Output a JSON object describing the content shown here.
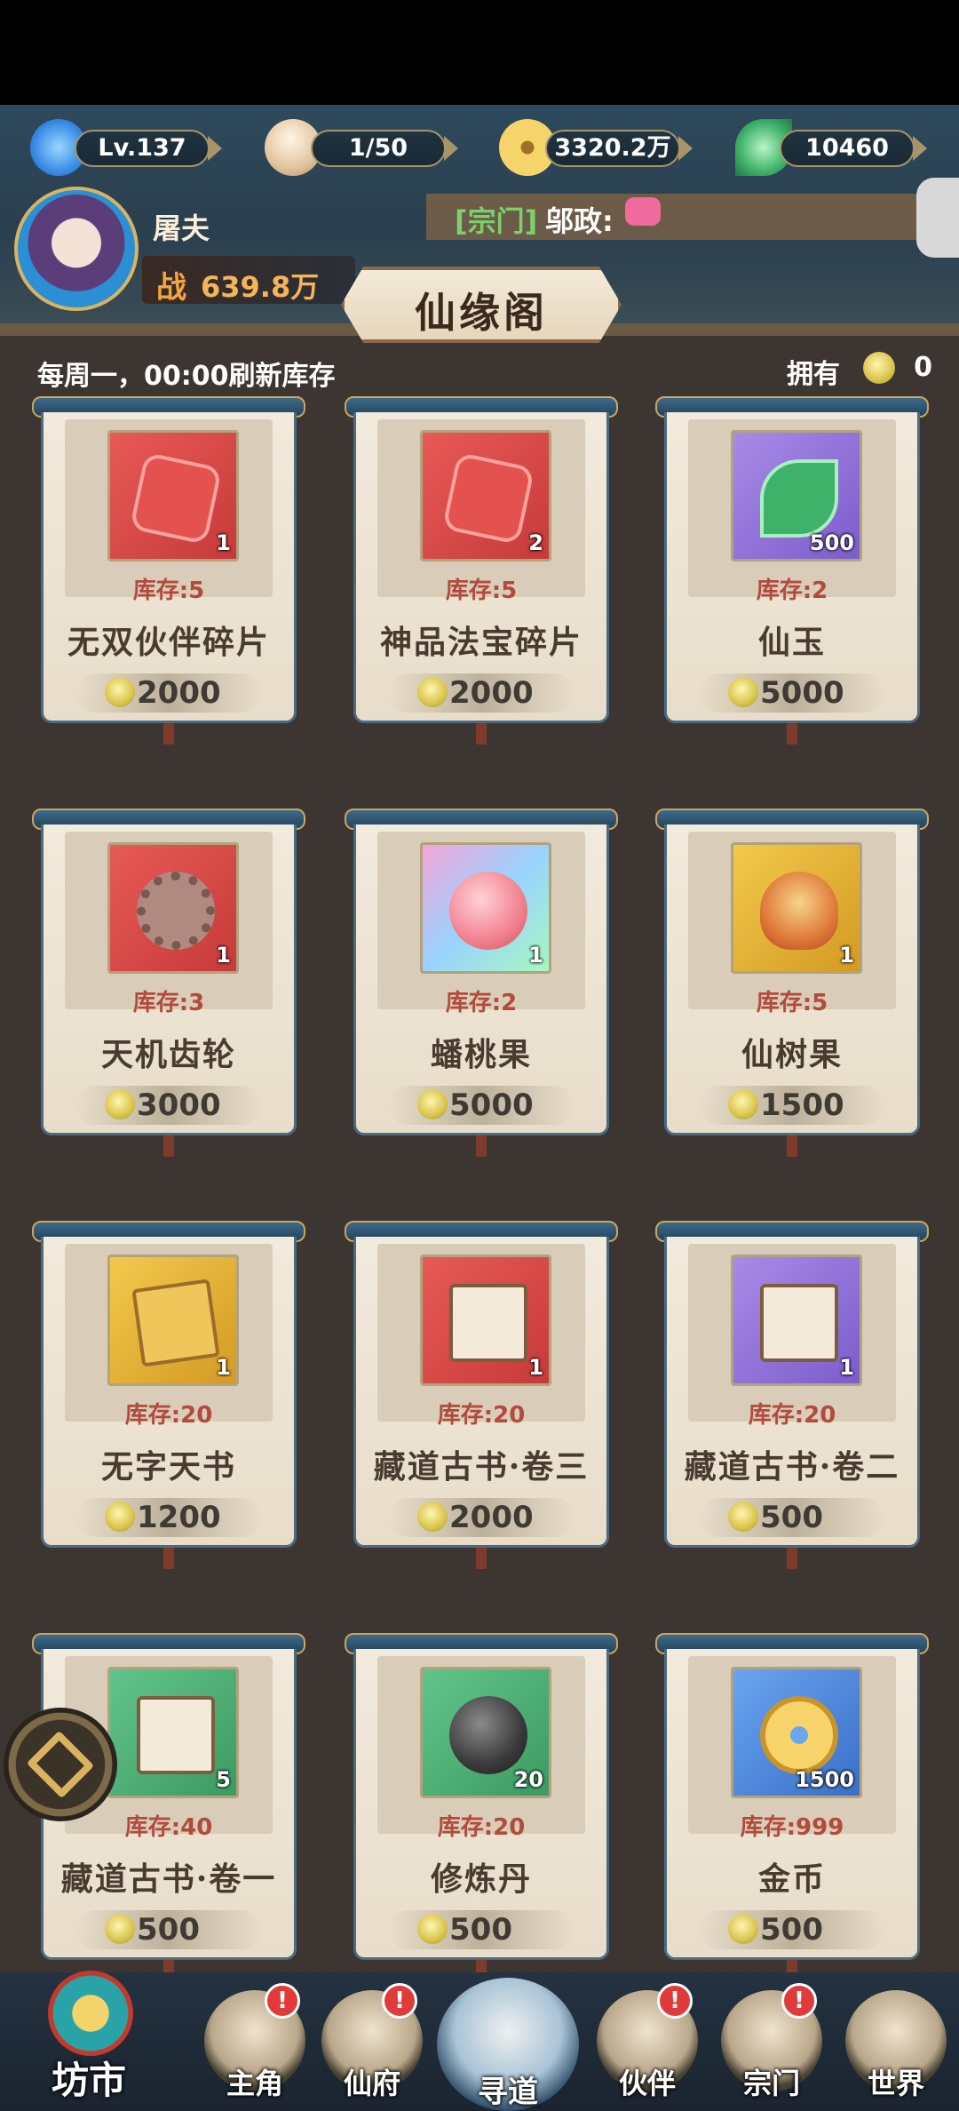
{
  "header": {
    "level": "Lv.137",
    "stamina": "1/50",
    "gold": "3320.2万",
    "jade": "10460"
  },
  "player": {
    "name": "屠夫",
    "power_label": "战",
    "power_value": "639.8万"
  },
  "chat": {
    "tag": "[宗门]",
    "message": "邬政:"
  },
  "shop": {
    "title": "仙缘阁",
    "refresh_note": "每周一，00:00刷新库存",
    "owned_label": "拥有",
    "owned_count": "0"
  },
  "items": [
    {
      "name": "无双伙伴碎片",
      "stock": "库存:5",
      "qty": "1",
      "price": "2000",
      "bg": "bg-red",
      "art": "art-piece",
      "icon": "puzzle-piece-icon"
    },
    {
      "name": "神品法宝碎片",
      "stock": "库存:5",
      "qty": "2",
      "price": "2000",
      "bg": "bg-red",
      "art": "art-piece",
      "icon": "puzzle-fragment-icon"
    },
    {
      "name": "仙玉",
      "stock": "库存:2",
      "qty": "500",
      "price": "5000",
      "bg": "bg-purple",
      "art": "art-leaf",
      "icon": "jade-leaf-icon"
    },
    {
      "name": "天机齿轮",
      "stock": "库存:3",
      "qty": "1",
      "price": "3000",
      "bg": "bg-red",
      "art": "art-gear",
      "icon": "gear-icon"
    },
    {
      "name": "蟠桃果",
      "stock": "库存:2",
      "qty": "1",
      "price": "5000",
      "bg": "bg-rainbow",
      "art": "art-peach",
      "icon": "peach-icon"
    },
    {
      "name": "仙树果",
      "stock": "库存:5",
      "qty": "1",
      "price": "1500",
      "bg": "bg-gold",
      "art": "art-fruit",
      "icon": "tree-fruit-icon"
    },
    {
      "name": "无字天书",
      "stock": "库存:20",
      "qty": "1",
      "price": "1200",
      "bg": "bg-gold",
      "art": "art-scroll",
      "icon": "scripture-icon"
    },
    {
      "name": "藏道古书·卷三",
      "stock": "库存:20",
      "qty": "1",
      "price": "2000",
      "bg": "bg-red",
      "art": "art-book",
      "icon": "open-book-icon"
    },
    {
      "name": "藏道古书·卷二",
      "stock": "库存:20",
      "qty": "1",
      "price": "500",
      "bg": "bg-purple",
      "art": "art-book",
      "icon": "open-book-icon"
    },
    {
      "name": "藏道古书·卷一",
      "stock": "库存:40",
      "qty": "5",
      "price": "500",
      "bg": "bg-green",
      "art": "art-book",
      "icon": "open-book-icon"
    },
    {
      "name": "修炼丹",
      "stock": "库存:20",
      "qty": "20",
      "price": "500",
      "bg": "bg-green",
      "art": "art-pill",
      "icon": "pill-icon"
    },
    {
      "name": "金币",
      "stock": "库存:999",
      "qty": "1500",
      "price": "500",
      "bg": "bg-blue",
      "art": "art-coin",
      "icon": "gold-coin-icon"
    }
  ],
  "nav": {
    "shop": "坊市",
    "hero": "主角",
    "mansion": "仙府",
    "xundao": "寻道",
    "partner": "伙伴",
    "sect": "宗门",
    "world": "世界",
    "badge": "!"
  }
}
